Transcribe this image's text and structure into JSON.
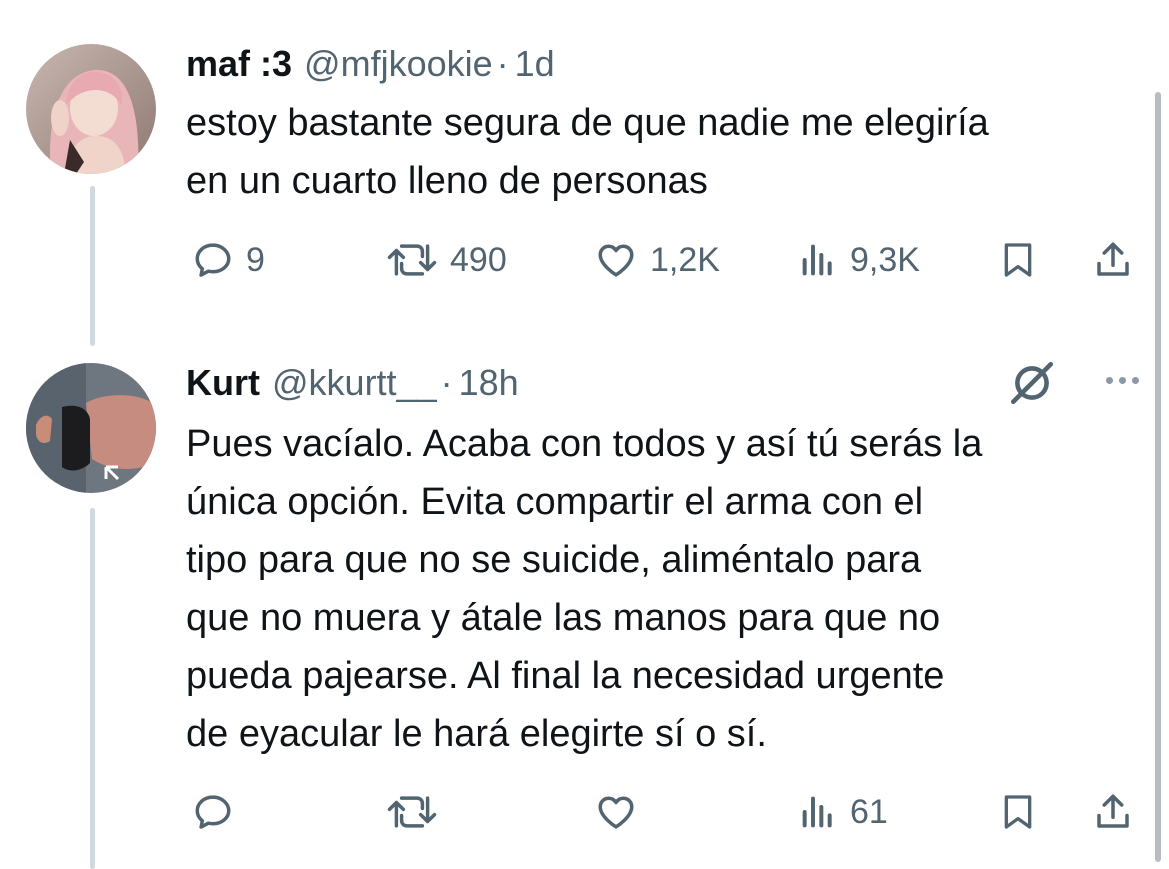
{
  "tweets": [
    {
      "display_name": "maf :3",
      "handle": "@mfjkookie",
      "separator": "·",
      "time": "1d",
      "text_lines": [
        "estoy bastante segura de que nadie me elegiría",
        "en un cuarto lleno de personas"
      ],
      "stats": {
        "replies": "9",
        "reposts": "490",
        "likes": "1,2K",
        "views": "9,3K"
      }
    },
    {
      "display_name": "Kurt",
      "handle": "@kkurtt__",
      "separator": "·",
      "time": "18h",
      "text_lines": [
        "Pues vacíalo. Acaba con todos y así tú serás la",
        "única opción. Evita compartir el arma con el",
        "tipo para que no se suicide, aliméntalo para",
        "que no muera y átale las manos para que no",
        "pueda pajearse. Al final la necesidad urgente",
        "de eyacular le hará elegirte sí o sí."
      ],
      "stats": {
        "replies": "",
        "reposts": "",
        "likes": "",
        "views": "61"
      }
    }
  ],
  "icons": {
    "reply": "reply-icon",
    "repost": "repost-icon",
    "like": "like-icon",
    "views": "views-icon",
    "bookmark": "bookmark-icon",
    "share": "share-icon",
    "grok": "grok-icon",
    "more": "more-icon"
  },
  "colors": {
    "text": "#0f1419",
    "secondary": "#536471",
    "thread_line": "#cfd9de"
  }
}
